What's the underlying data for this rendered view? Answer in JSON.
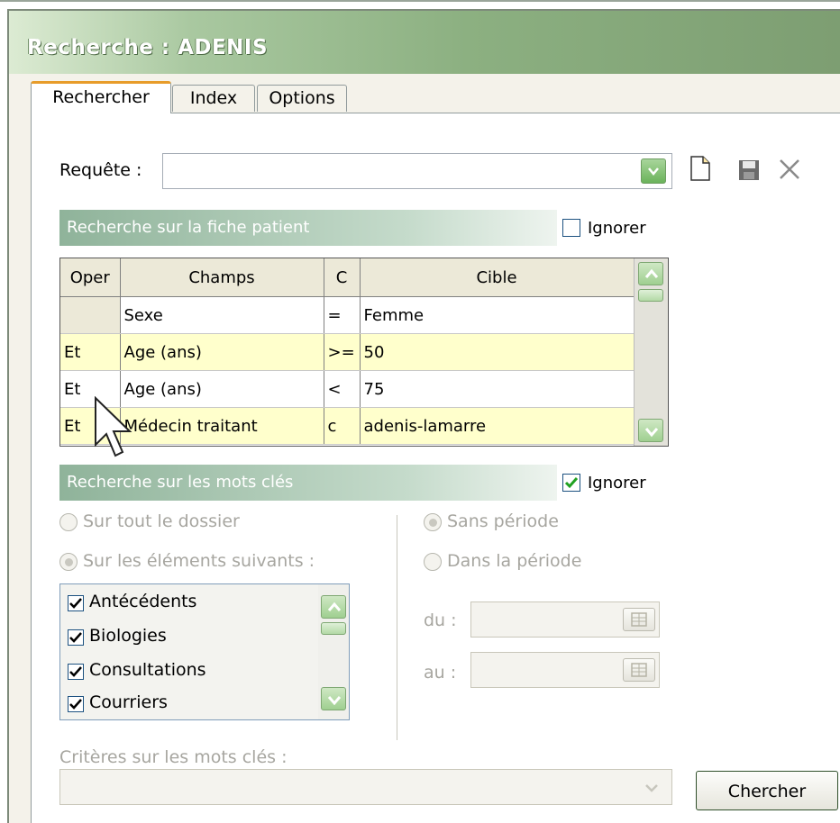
{
  "window": {
    "title": "Recherche : ADENIS"
  },
  "tabs": [
    {
      "label": "Rechercher",
      "active": true
    },
    {
      "label": "Index",
      "active": false
    },
    {
      "label": "Options",
      "active": false
    }
  ],
  "requete": {
    "label": "Requête :",
    "value": ""
  },
  "toolbar": {
    "new_icon": "new-document-icon",
    "save_icon": "save-icon",
    "delete_icon": "delete-x-icon"
  },
  "patient_section": {
    "title": "Recherche sur la fiche patient",
    "ignore_label": "Ignorer",
    "ignore_checked": false,
    "columns": [
      "Oper",
      "Champs",
      "C",
      "Cible"
    ],
    "rows": [
      {
        "oper": "",
        "champ": "Sexe",
        "c": "=",
        "cible": "Femme"
      },
      {
        "oper": "Et",
        "champ": "Age (ans)",
        "c": ">=",
        "cible": "50"
      },
      {
        "oper": "Et",
        "champ": "Age (ans)",
        "c": "<",
        "cible": "75"
      },
      {
        "oper": "Et",
        "champ": "Médecin traitant",
        "c": "c",
        "cible": "adenis-lamarre"
      }
    ]
  },
  "keywords_section": {
    "title": "Recherche sur les mots clés",
    "ignore_label": "Ignorer",
    "ignore_checked": true,
    "scope_options": [
      "Sur tout le dossier",
      "Sur les éléments suivants :"
    ],
    "scope_selected": "Sur les éléments suivants :",
    "period_options": [
      "Sans période",
      "Dans la période"
    ],
    "period_selected": "Sans période",
    "elements": [
      {
        "label": "Antécédents",
        "checked": true
      },
      {
        "label": "Biologies",
        "checked": true
      },
      {
        "label": "Consultations",
        "checked": true
      },
      {
        "label": "Courriers",
        "checked": true
      }
    ],
    "du_label": "du :",
    "au_label": "au :",
    "criteria_label": "Critères sur les mots clés :"
  },
  "search_button": "Chercher"
}
